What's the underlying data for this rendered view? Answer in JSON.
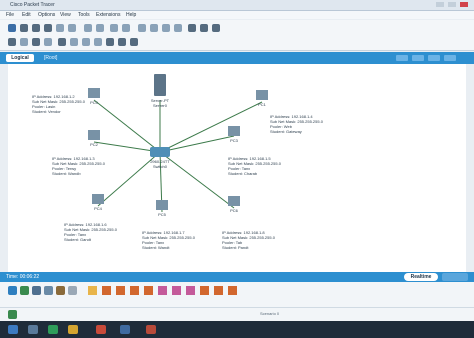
{
  "window": {
    "app_title": "Cisco Packet Tracer",
    "center_title": "",
    "buttons": [
      "minimize",
      "maximize",
      "close"
    ]
  },
  "menu": [
    "File",
    "Edit",
    "Options",
    "View",
    "Tools",
    "Extensions",
    "Help"
  ],
  "toolbar": {
    "icons_row1": [
      "new-icon",
      "open-icon",
      "save-icon",
      "print-icon",
      "wizard-icon",
      "network-info-icon",
      "copy-icon",
      "paste-icon",
      "undo-icon",
      "redo-icon",
      "zoom-in-icon",
      "zoom-out-icon",
      "reset-zoom-icon",
      "drawing-palette-icon",
      "custom-devices-icon",
      "pdu-icon",
      "custom-pdu-icon"
    ],
    "icons_row2": [
      "select-icon",
      "inspect-icon",
      "delete-icon",
      "resize-icon",
      "note-icon",
      "line-icon",
      "rectangle-icon",
      "ellipse-icon",
      "freeform-icon",
      "simple-pdu-icon",
      "complex-pdu-icon"
    ]
  },
  "tabs": {
    "logical": "Logical",
    "path": "[Root]"
  },
  "devices": {
    "server": {
      "name": "Server-PT",
      "sub": "Server0"
    },
    "switch": {
      "name": "2960-24TT",
      "sub": "Switch0"
    },
    "pc0": {
      "name": "PC-PT",
      "sub": "PC0"
    },
    "pc1": {
      "name": "PC-PT",
      "sub": "PC1"
    },
    "pc2": {
      "name": "PC-PT",
      "sub": "PC2"
    },
    "pc3": {
      "name": "PC-PT",
      "sub": "PC3"
    },
    "pc4": {
      "name": "PC-PT",
      "sub": "PC4"
    },
    "pc5": {
      "name": "PC-PT",
      "sub": "PC5"
    },
    "pc6": {
      "name": "PC-PT",
      "sub": "PC6"
    }
  },
  "labels": {
    "pc_top_left": [
      "IP Address: 192.168.1.2",
      "Sub Net Mask: 255.255.255.0",
      "Pooler: Lasin",
      "Student: Vendor"
    ],
    "pc_top_right": [
      "IP Address: 192.168.1.4",
      "Sub Net Mask: 255.255.255.0",
      "Pooler: Web",
      "Student: Gateway"
    ],
    "pc_mid_left": [
      "IP Address: 192.168.1.3",
      "Sub Net Mask: 255.255.255.0",
      "Pooler: Terwy",
      "Student: Wandb"
    ],
    "pc_mid_right": [
      "IP Address: 192.168.1.5",
      "Sub Net Mask: 255.255.255.0",
      "Pooler: Tanx",
      "Student: Charab"
    ],
    "pc_bot_left": [
      "IP Address: 192.168.1.6",
      "Sub Net Mask: 255.255.255.0",
      "Pooler: Tanx",
      "Student: Gandt"
    ],
    "pc_bot_mid": [
      "IP Address: 192.168.1.7",
      "Sub Net Mask: 255.255.255.0",
      "Pooler: Tanx",
      "Student: Wandt"
    ],
    "pc_bot_right": [
      "IP Address: 192.168.1.8",
      "Sub Net Mask: 255.255.255.0",
      "Pooler: Tab",
      "Student: Pandt"
    ]
  },
  "status": {
    "time": "Time: 00:06:22",
    "mode": "Realtime"
  },
  "lower": {
    "scenario": "Scenario 0"
  },
  "colors": {
    "accent": "#2d8fd0",
    "link": "#3c7a4a",
    "taskbar": "#1f2c3a"
  }
}
